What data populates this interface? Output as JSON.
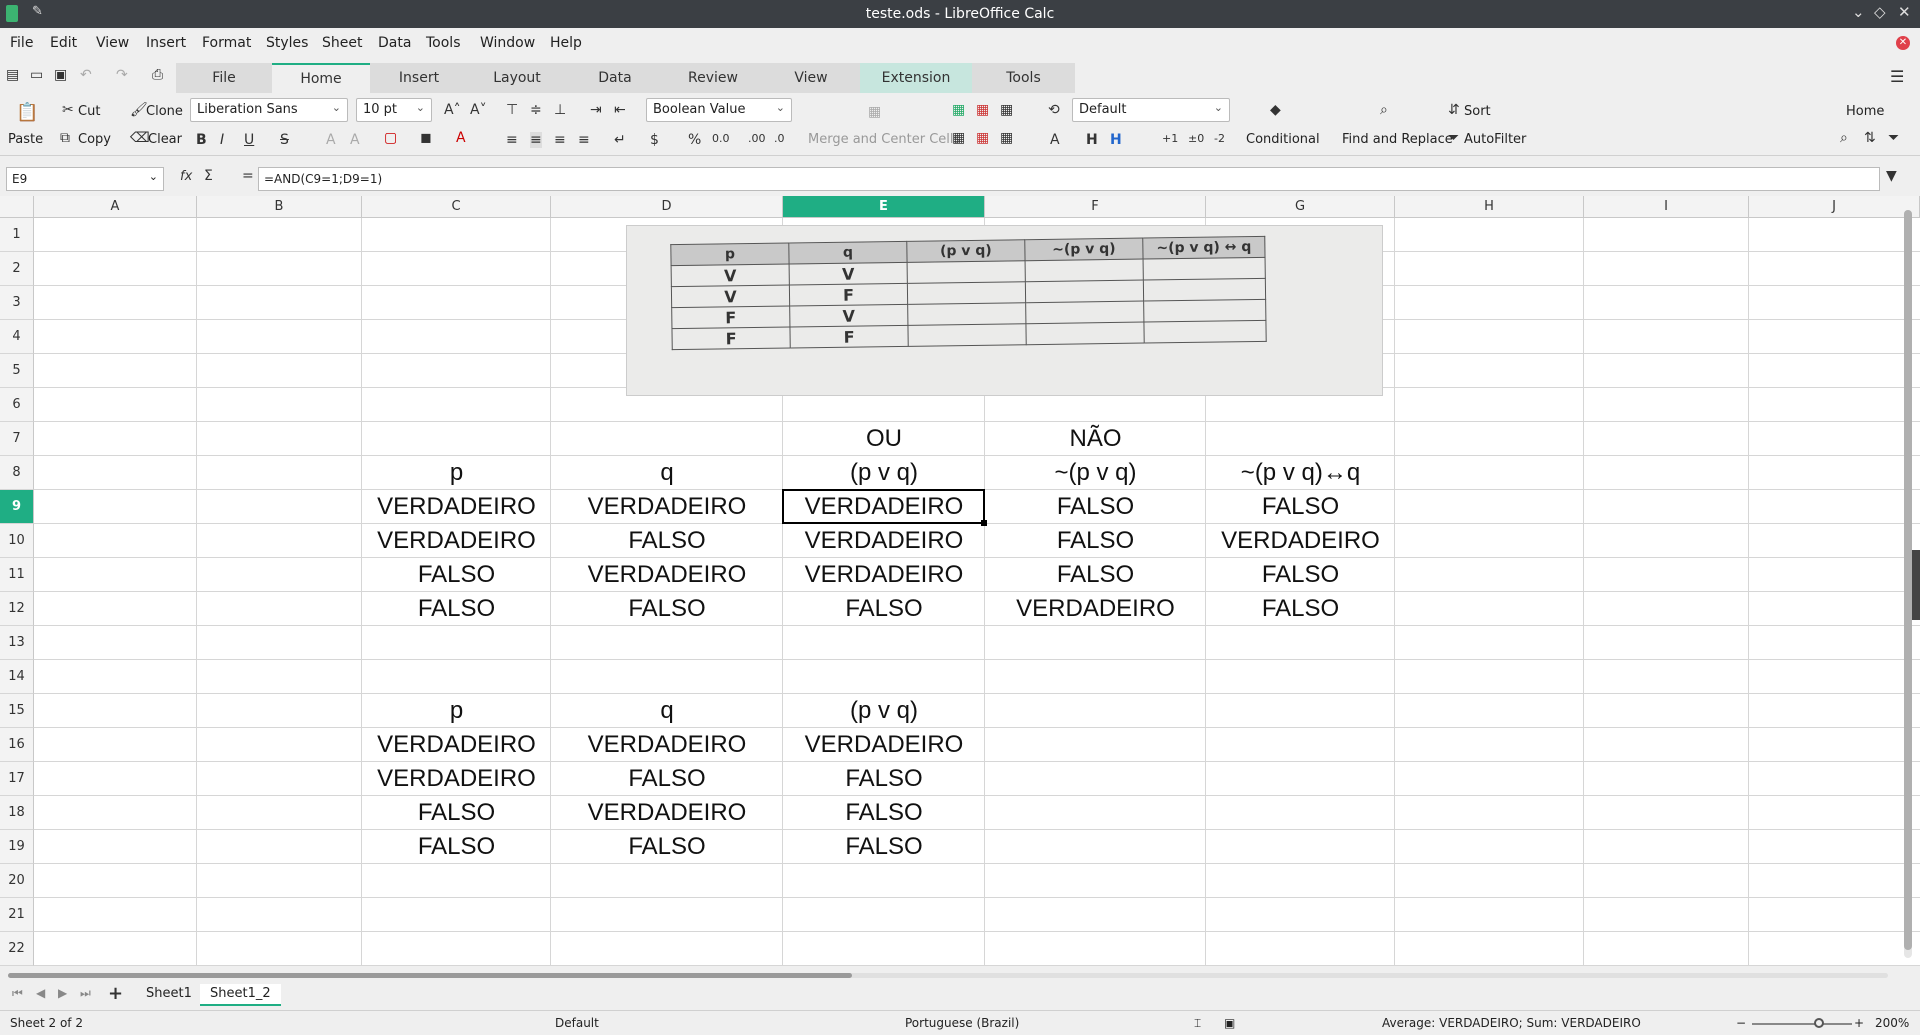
{
  "window": {
    "title": "teste.ods - LibreOffice Calc"
  },
  "menu": [
    "File",
    "Edit",
    "View",
    "Insert",
    "Format",
    "Styles",
    "Sheet",
    "Data",
    "Tools",
    "Window",
    "Help"
  ],
  "tabs": [
    "File",
    "Home",
    "Insert",
    "Layout",
    "Data",
    "Review",
    "View",
    "Extension",
    "Tools"
  ],
  "ribbon": {
    "paste": "Paste",
    "cut": "Cut",
    "clone": "Clone",
    "copy": "Copy",
    "clear": "Clear",
    "font_name": "Liberation Sans",
    "font_size": "10 pt",
    "number_format": "Boolean Value",
    "merge": "Merge and Center Cells",
    "cell_style": "Default",
    "conditional": "Conditional",
    "find_replace": "Find and Replace",
    "sort": "Sort",
    "autofilter": "AutoFilter",
    "home_menu": "Home"
  },
  "formula_bar": {
    "cell_ref": "E9",
    "formula": "=AND(C9=1;D9=1)"
  },
  "columns": [
    "A",
    "B",
    "C",
    "D",
    "E",
    "F",
    "G",
    "H",
    "I",
    "J"
  ],
  "rows": [
    "1",
    "2",
    "3",
    "4",
    "5",
    "6",
    "7",
    "8",
    "9",
    "10",
    "11",
    "12",
    "13",
    "14",
    "15",
    "16",
    "17",
    "18",
    "19",
    "20",
    "21",
    "22"
  ],
  "image_table": {
    "headers": [
      "p",
      "q",
      "(p v q)",
      "~(p v q)",
      "~(p v q) ↔ q"
    ],
    "rows": [
      [
        "V",
        "V",
        "",
        "",
        ""
      ],
      [
        "V",
        "F",
        "",
        "",
        ""
      ],
      [
        "F",
        "V",
        "",
        "",
        ""
      ],
      [
        "F",
        "F",
        "",
        "",
        ""
      ]
    ]
  },
  "cells": {
    "E7": "OU",
    "F7": "NÃO",
    "C8": "p",
    "D8": "q",
    "E8": "(p v q)",
    "F8": "~(p v q)",
    "G8": "~(p v q)↔q",
    "C9": "VERDADEIRO",
    "D9": "VERDADEIRO",
    "E9": "VERDADEIRO",
    "F9": "FALSO",
    "G9": "FALSO",
    "C10": "VERDADEIRO",
    "D10": "FALSO",
    "E10": "VERDADEIRO",
    "F10": "FALSO",
    "G10": "VERDADEIRO",
    "C11": "FALSO",
    "D11": "VERDADEIRO",
    "E11": "VERDADEIRO",
    "F11": "FALSO",
    "G11": "FALSO",
    "C12": "FALSO",
    "D12": "FALSO",
    "E12": "FALSO",
    "F12": "VERDADEIRO",
    "G12": "FALSO",
    "C15": "p",
    "D15": "q",
    "E15": "(p v q)",
    "C16": "VERDADEIRO",
    "D16": "VERDADEIRO",
    "E16": "VERDADEIRO",
    "C17": "VERDADEIRO",
    "D17": "FALSO",
    "E17": "FALSO",
    "C18": "FALSO",
    "D18": "VERDADEIRO",
    "E18": "FALSO",
    "C19": "FALSO",
    "D19": "FALSO",
    "E19": "FALSO"
  },
  "sheets": [
    "Sheet1",
    "Sheet1_2"
  ],
  "status": {
    "sheet_pos": "Sheet 2 of 2",
    "page_style": "Default",
    "language": "Portuguese (Brazil)",
    "summary": "Average: VERDADEIRO; Sum: VERDADEIRO",
    "zoom": "200%"
  }
}
